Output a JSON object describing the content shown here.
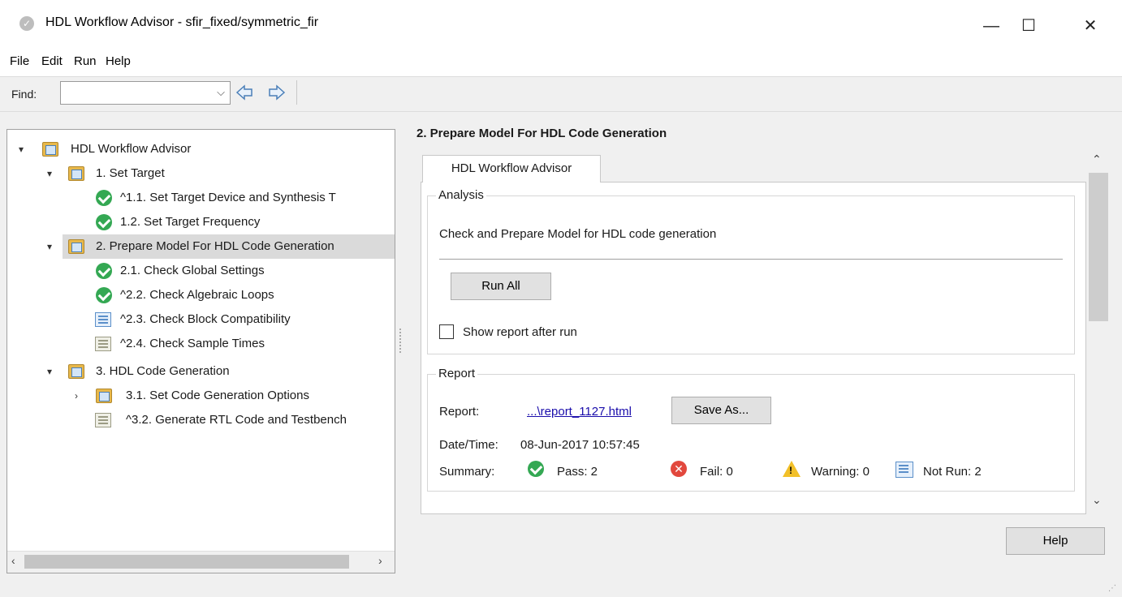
{
  "window": {
    "title": "HDL Workflow Advisor - sfir_fixed/symmetric_fir",
    "app_icon": "matlab-check-icon",
    "minimize": "—",
    "maximize": "☐",
    "close": "✕"
  },
  "menu": [
    "File",
    "Edit",
    "Run",
    "Help"
  ],
  "toolbar": {
    "find_label": "Find:",
    "find_value": ""
  },
  "tree": {
    "root": "HDL Workflow Advisor",
    "items": [
      {
        "label": "1. Set Target"
      },
      {
        "label": "^1.1. Set Target Device and Synthesis T"
      },
      {
        "label": "1.2. Set Target Frequency"
      },
      {
        "label": "2. Prepare Model For HDL Code Generation"
      },
      {
        "label": "2.1. Check Global Settings"
      },
      {
        "label": "^2.2. Check Algebraic Loops"
      },
      {
        "label": "^2.3. Check Block Compatibility"
      },
      {
        "label": "^2.4. Check Sample Times"
      },
      {
        "label": "3. HDL Code Generation"
      },
      {
        "label": "3.1. Set Code Generation Options"
      },
      {
        "label": "^3.2. Generate RTL Code and Testbench"
      }
    ]
  },
  "main": {
    "title": "2. Prepare Model For HDL Code Generation",
    "tab": "HDL Workflow Advisor",
    "analysis": {
      "label": "Analysis",
      "description": "Check and Prepare Model for HDL code generation",
      "run_all": "Run All",
      "show_report": "Show report after run"
    },
    "report": {
      "label": "Report",
      "report_label": "Report:",
      "report_link": "...\\report_1127.html",
      "save_as": "Save As...",
      "datetime_label": "Date/Time:",
      "datetime_value": "08-Jun-2017 10:57:45",
      "summary_label": "Summary:",
      "pass": "Pass: 2",
      "fail": "Fail: 0",
      "warning": "Warning: 0",
      "not_run": "Not Run: 2"
    },
    "help": "Help"
  }
}
